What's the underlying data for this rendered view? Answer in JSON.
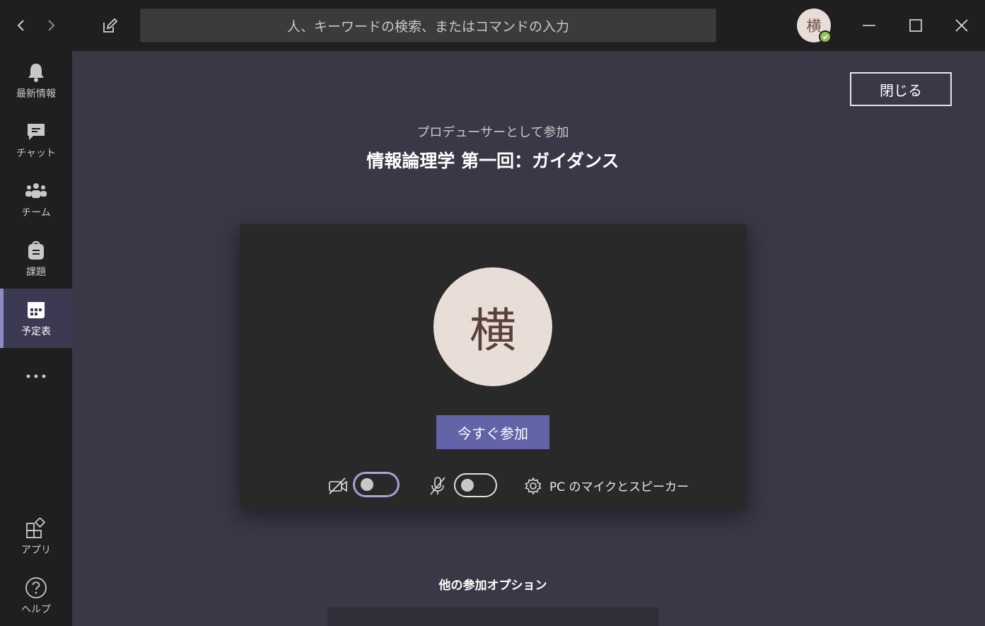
{
  "titlebar": {
    "search_placeholder": "人、キーワードの検索、またはコマンドの入力",
    "user_initial": "横"
  },
  "rail": {
    "items": [
      {
        "label": "最新情報",
        "icon": "bell-icon"
      },
      {
        "label": "チャット",
        "icon": "chat-icon"
      },
      {
        "label": "チーム",
        "icon": "teams-icon"
      },
      {
        "label": "課題",
        "icon": "assignments-icon"
      },
      {
        "label": "予定表",
        "icon": "calendar-icon",
        "active": true
      }
    ],
    "bottom": [
      {
        "label": "アプリ",
        "icon": "apps-icon"
      },
      {
        "label": "ヘルプ",
        "icon": "help-icon"
      }
    ]
  },
  "meeting": {
    "close_label": "閉じる",
    "join_as": "プロデューサーとして参加",
    "title": "情報論理学 第一回：ガイダンス",
    "avatar_initial": "横",
    "join_now_label": "今すぐ参加",
    "camera_on": false,
    "mic_on": false,
    "device_label": "PC のマイクとスピーカー",
    "other_options_title": "他の参加オプション"
  },
  "colors": {
    "accent": "#6264a7",
    "background": "#383846",
    "rail": "#1f1f1f",
    "presence": "#92c353"
  }
}
